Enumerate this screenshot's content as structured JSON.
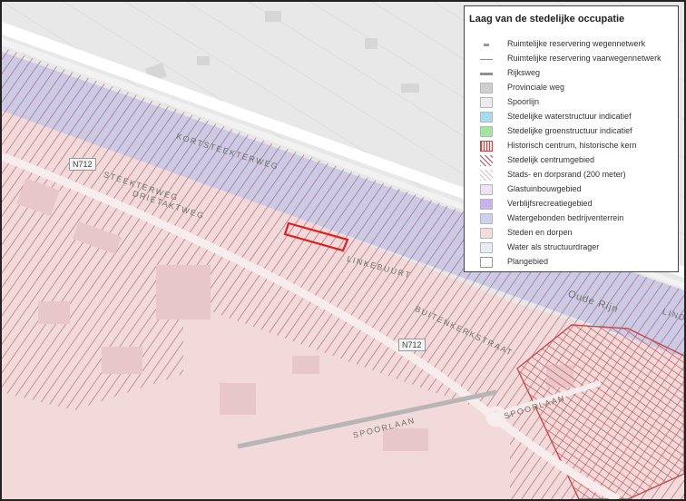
{
  "map": {
    "streets": {
      "kortsteekterweg": "KORTSTEEKTERWEG",
      "steekterweg": "STEEKTERWEG",
      "dreitakt": "DRIETAKTWEG",
      "linkerbuurt": "LINKEBUURT",
      "buitenkerk": "BUITENKERKSTRAAT",
      "spoorlaan1": "SPOORLAAN",
      "spoorlaan2": "SPOORLAAN",
      "oude_rijn": "Oude Rijn",
      "linde": "LIND"
    },
    "road_numbers": {
      "n712_left": "N712",
      "n712_right": "N712"
    }
  },
  "legend": {
    "title": "Laag van de stedelijke occupatie",
    "items": [
      {
        "label": "Ruimtelijke reservering wegennetwerk",
        "swatch": "dash-gray",
        "color": "#9a9a9a"
      },
      {
        "label": "Ruimtelijke reservering vaarwegennetwerk",
        "swatch": "line-red",
        "color": "#e06a6a"
      },
      {
        "label": "Rijksweg",
        "swatch": "line-gray",
        "color": "#8f8f8f"
      },
      {
        "label": "Provinciale weg",
        "swatch": "fill",
        "color": "#cfcfcf"
      },
      {
        "label": "Spoorlijn",
        "swatch": "fill",
        "color": "#ececec"
      },
      {
        "label": "Stedelijke waterstructuur indicatief",
        "swatch": "fill",
        "color": "#a6dcf2"
      },
      {
        "label": "Stedelijke groenstructuur indicatief",
        "swatch": "fill",
        "color": "#a3e6a0"
      },
      {
        "label": "Historisch centrum, historische kern",
        "swatch": "vlines",
        "color": "#c64a4a"
      },
      {
        "label": "Stedelijk centrumgebied",
        "swatch": "hatch",
        "color": "#a35566"
      },
      {
        "label": "Stads- en dorpsrand (200 meter)",
        "swatch": "hatch-light",
        "color": "#d8c3c8"
      },
      {
        "label": "Glastuinbouwgebied",
        "swatch": "fill",
        "color": "#f1e3f4"
      },
      {
        "label": "Verblijfsrecreatiegebied",
        "swatch": "fill",
        "color": "#c5b3ec"
      },
      {
        "label": "Watergebonden bedrijventerrein",
        "swatch": "fill",
        "color": "#cdd0ef"
      },
      {
        "label": "Steden en dorpen",
        "swatch": "fill",
        "color": "#f5dcdc"
      },
      {
        "label": "Water als structuurdrager",
        "swatch": "fill",
        "color": "#e6eef4"
      },
      {
        "label": "Plangebied",
        "swatch": "outline",
        "color": "#999999"
      }
    ]
  }
}
